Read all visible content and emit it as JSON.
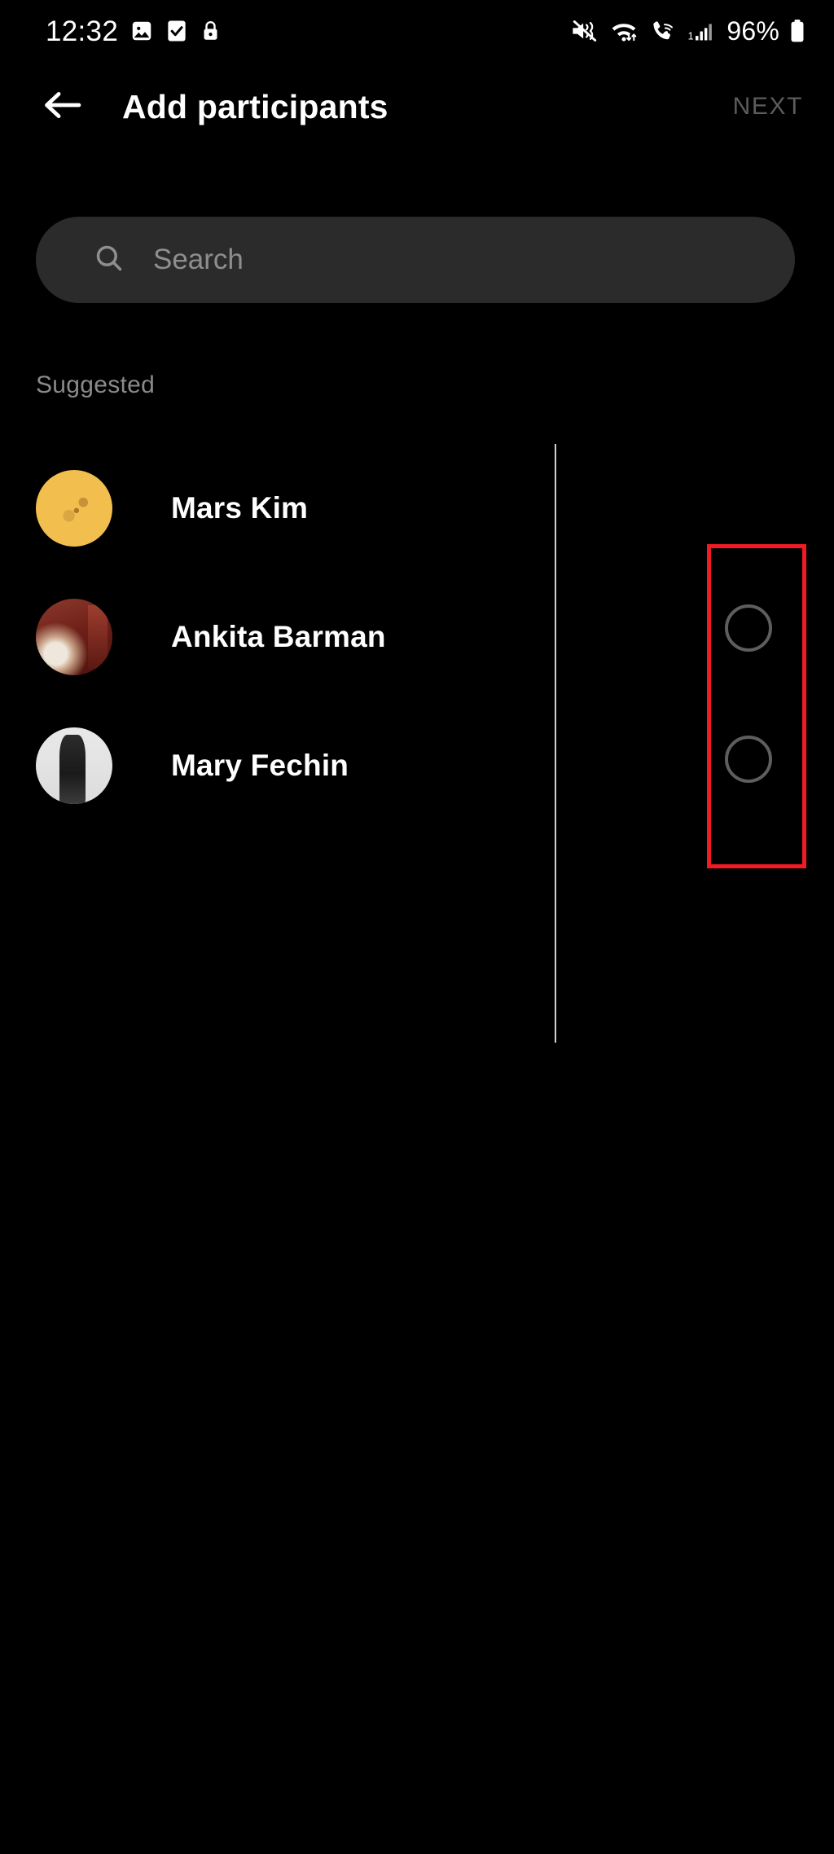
{
  "status_bar": {
    "time": "12:32",
    "battery_percent": "96%",
    "left_icons": [
      {
        "name": "screenshot-image-icon"
      },
      {
        "name": "checkbox-checked-icon"
      },
      {
        "name": "lock-icon"
      }
    ],
    "right_icons": [
      {
        "name": "volume-mute-vibrate-icon"
      },
      {
        "name": "wifi-data-transfer-icon"
      },
      {
        "name": "wifi-calling-icon"
      },
      {
        "name": "cellular-signal-icon",
        "sim": "1"
      },
      {
        "name": "battery-icon"
      }
    ]
  },
  "app_bar": {
    "back_icon": "arrow-left-icon",
    "title": "Add participants",
    "next_label": "NEXT",
    "next_enabled": false
  },
  "search": {
    "icon": "search-icon",
    "placeholder": "Search",
    "value": ""
  },
  "list": {
    "section_label": "Suggested",
    "contacts": [
      {
        "name": "Mars Kim",
        "avatar": "avatar-photo-yellow",
        "selected": false,
        "selector_visible": false
      },
      {
        "name": "Ankita Barman",
        "avatar": "avatar-photo-maroon",
        "selected": false,
        "selector_visible": true
      },
      {
        "name": "Mary Fechin",
        "avatar": "avatar-photo-grayscale",
        "selected": false,
        "selector_visible": true
      }
    ]
  },
  "annotation": {
    "type": "highlight-rectangle",
    "color": "#f01b23",
    "target": "selection-circles-column"
  },
  "colors": {
    "background": "#000000",
    "search_field": "#2b2b2b",
    "primary_text": "#ffffff",
    "secondary_text": "#8a8a8a",
    "disabled_text": "#5c5c5c",
    "selector_outline": "#5e5e5e",
    "annotation": "#f01b23"
  }
}
